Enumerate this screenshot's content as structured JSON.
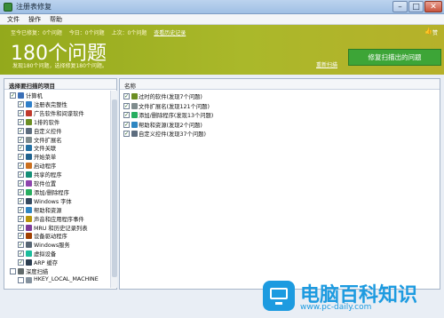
{
  "window": {
    "title": "注册表修复"
  },
  "menu": {
    "file": "文件",
    "action": "操作",
    "help": "帮助"
  },
  "banner": {
    "status_prefix": "至今已修复：0个问题",
    "status_today": "今日：0个问题",
    "status_last": "上次：0个问题",
    "history_link": "查看历史记录",
    "like_label": "赞",
    "count_text": "180个问题",
    "sub_text": "发现180个问题，选择修复180个问题。",
    "rescan_link": "重新扫描",
    "repair_button": "修复扫描出的问题"
  },
  "left_panel": {
    "header": "选择要扫描的项目",
    "items": [
      {
        "label": "计算机",
        "checked": true,
        "icon": "computer-icon",
        "level": 0
      },
      {
        "label": "注册表完整性",
        "checked": true,
        "icon": "registry-icon",
        "level": 1
      },
      {
        "label": "广告软件和间谍软件",
        "checked": true,
        "icon": "adware-icon",
        "level": 1
      },
      {
        "label": "1排的软件",
        "checked": true,
        "icon": "software-icon",
        "level": 1
      },
      {
        "label": "自定义控件",
        "checked": true,
        "icon": "control-icon",
        "level": 1
      },
      {
        "label": "文件扩展名",
        "checked": true,
        "icon": "file-ext-icon",
        "level": 1
      },
      {
        "label": "文件关联",
        "checked": true,
        "icon": "file-assoc-icon",
        "level": 1
      },
      {
        "label": "开始菜单",
        "checked": true,
        "icon": "start-menu-icon",
        "level": 1
      },
      {
        "label": "启动程序",
        "checked": true,
        "icon": "startup-icon",
        "level": 1
      },
      {
        "label": "共享的程序",
        "checked": true,
        "icon": "shared-icon",
        "level": 1
      },
      {
        "label": "软件位置",
        "checked": true,
        "icon": "location-icon",
        "level": 1
      },
      {
        "label": "添加/删除程序",
        "checked": true,
        "icon": "add-remove-icon",
        "level": 1
      },
      {
        "label": "Windows 字体",
        "checked": true,
        "icon": "font-icon",
        "level": 1
      },
      {
        "label": "帮助和资源",
        "checked": true,
        "icon": "help-icon",
        "level": 1
      },
      {
        "label": "声音和应用程序事件",
        "checked": true,
        "icon": "sound-icon",
        "level": 1
      },
      {
        "label": "MRU 和历史记录列表",
        "checked": true,
        "icon": "history-icon",
        "level": 1
      },
      {
        "label": "设备驱动程序",
        "checked": true,
        "icon": "driver-icon",
        "level": 1
      },
      {
        "label": "Windows服务",
        "checked": true,
        "icon": "service-icon",
        "level": 1
      },
      {
        "label": "虚拟设备",
        "checked": true,
        "icon": "virtual-device-icon",
        "level": 1
      },
      {
        "label": "ARP 缓存",
        "checked": true,
        "icon": "arp-icon",
        "level": 1
      },
      {
        "label": "深度扫描",
        "checked": false,
        "icon": "deep-scan-icon",
        "level": 0
      },
      {
        "label": "HKEY_LOCAL_MACHINE",
        "checked": false,
        "icon": "hive-icon",
        "level": 1
      }
    ]
  },
  "right_panel": {
    "header": "名称",
    "items": [
      {
        "label": "过时的软件(发现7个问题)",
        "icon": "software-icon"
      },
      {
        "label": "文件扩展名(发现121个问题)",
        "icon": "file-ext-icon"
      },
      {
        "label": "添加/删除程序(发现13个问题)",
        "icon": "add-remove-icon"
      },
      {
        "label": "帮助和资源(发现2个问题)",
        "icon": "help-icon"
      },
      {
        "label": "自定义控件(发现37个问题)",
        "icon": "control-icon"
      }
    ]
  },
  "watermark": {
    "title": "电脑百科知识",
    "url": "www.pc-daily.com"
  },
  "colors": {
    "banner": "#a4b526",
    "repair_button": "#3da537",
    "watermark": "#1d9be0"
  }
}
